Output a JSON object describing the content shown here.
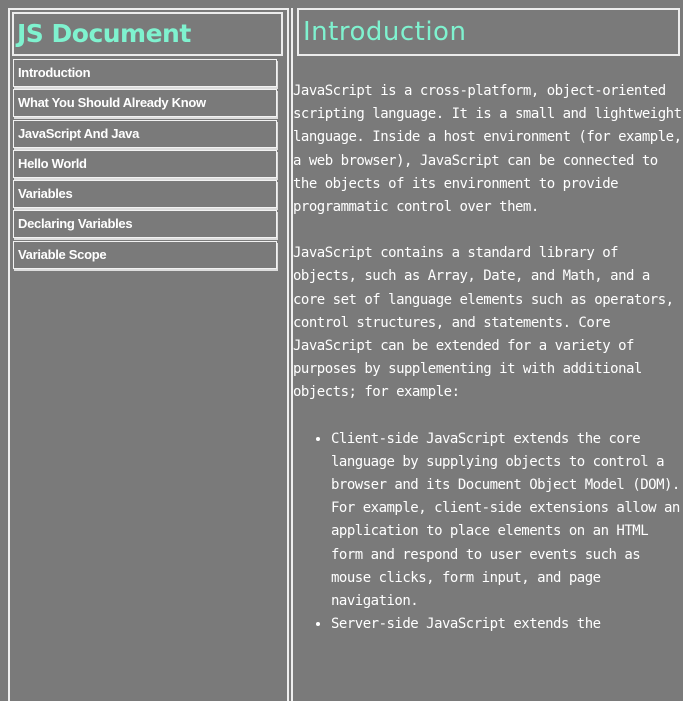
{
  "navbar": {
    "title": "JS Document",
    "links": [
      "Introduction",
      "What You Should Already Know",
      "JavaScript And Java",
      "Hello World",
      "Variables",
      "Declaring Variables",
      "Variable Scope"
    ]
  },
  "main": {
    "section_title": "Introduction",
    "paragraphs": [
      "JavaScript is a cross-platform, object-oriented scripting language. It is a small and lightweight language. Inside a host environment (for example, a web browser), JavaScript can be connected to the objects of its environment to provide programmatic control over them.",
      "JavaScript contains a standard library of objects, such as Array, Date, and Math, and a core set of language elements such as operators, control structures, and statements. Core JavaScript can be extended for a variety of purposes by supplementing it with additional objects; for example:"
    ],
    "list_items": [
      "Client-side JavaScript extends the core language by supplying objects to control a browser and its Document Object Model (DOM). For example, client-side extensions allow an application to place elements on an HTML form and respond to user events such as mouse clicks, form input, and page navigation.",
      "Server-side JavaScript extends the"
    ]
  },
  "colors": {
    "background": "#7a7a7a",
    "heading_accent": "#7ff2cf",
    "border": "#efefef",
    "text": "#ffffff"
  }
}
